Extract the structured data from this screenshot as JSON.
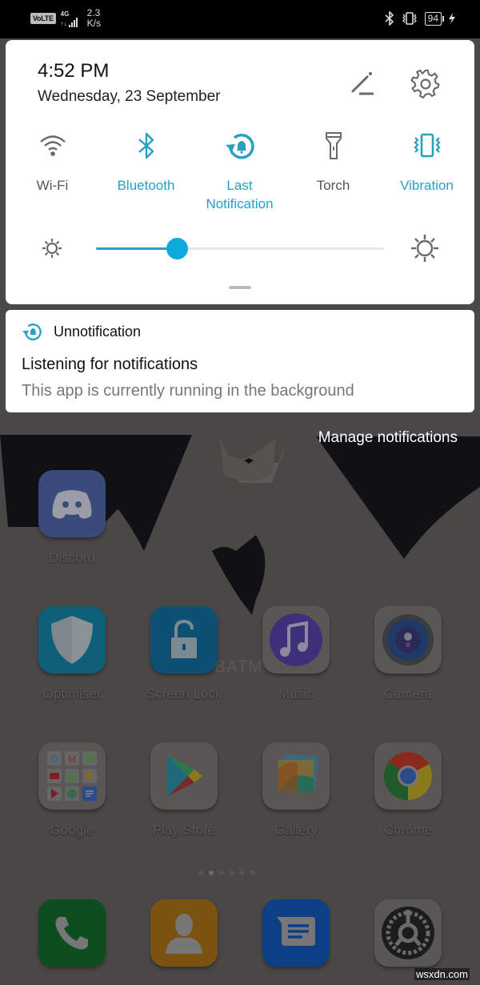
{
  "status_bar": {
    "volte": "VoLTE",
    "network": "4G",
    "speed_value": "2.3",
    "speed_unit": "K/s",
    "battery": "94"
  },
  "quick_settings": {
    "time": "4:52 PM",
    "date": "Wednesday, 23 September",
    "tiles": [
      {
        "label": "Wi-Fi",
        "icon": "wifi-icon",
        "active": false
      },
      {
        "label": "Bluetooth",
        "icon": "bluetooth-icon",
        "active": true
      },
      {
        "label": "Last Notification",
        "icon": "notification-history-icon",
        "active": true
      },
      {
        "label": "Torch",
        "icon": "torch-icon",
        "active": false
      },
      {
        "label": "Vibration",
        "icon": "vibration-icon",
        "active": true
      }
    ],
    "brightness_percent": 28,
    "accent_color": "#27a0c4"
  },
  "notification": {
    "app_name": "Unnotification",
    "title": "Listening for notifications",
    "text": "This app is currently running in the background"
  },
  "manage_notifications": "Manage notifications",
  "home": {
    "wallpaper_text": "BATM",
    "apps": [
      {
        "name": "Discord",
        "color": "#3a4a7a"
      },
      {
        "name": "Optimiser",
        "color": "#0f5f78"
      },
      {
        "name": "Screen Lock",
        "color": "#0e4f74"
      },
      {
        "name": "Music",
        "color": "#555"
      },
      {
        "name": "Camera",
        "color": "#555"
      },
      {
        "name": "Google",
        "color": "#555"
      },
      {
        "name": "Play Store",
        "color": "#555"
      },
      {
        "name": "Gallery",
        "color": "#555"
      },
      {
        "name": "Chrome",
        "color": "#555"
      }
    ],
    "dock": [
      {
        "name": "Phone",
        "color": "#0e4d1f"
      },
      {
        "name": "Contacts",
        "color": "#7a5310"
      },
      {
        "name": "Messages",
        "color": "#0d3f86"
      },
      {
        "name": "Settings",
        "color": "#555"
      }
    ]
  },
  "watermark": "wsxdn.com"
}
